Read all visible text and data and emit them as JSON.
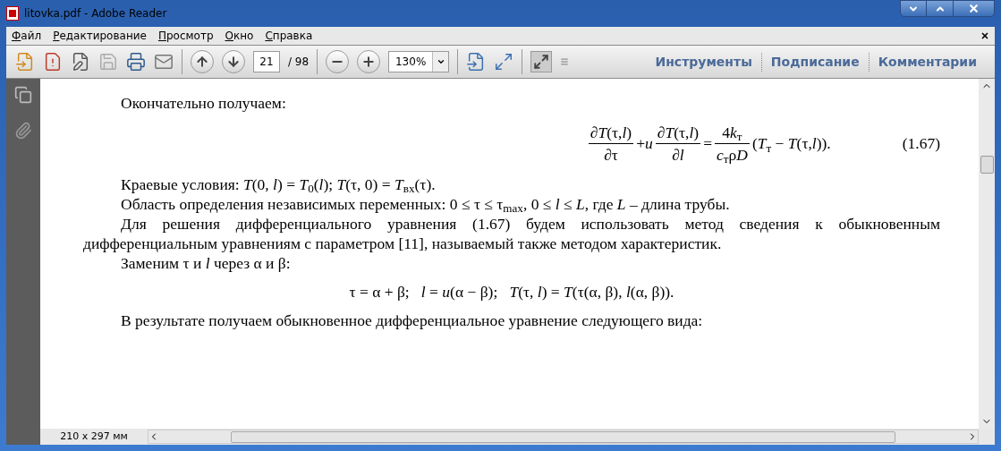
{
  "window": {
    "title": "litovka.pdf - Adobe Reader"
  },
  "menu": [
    "Файл",
    "Редактирование",
    "Просмотр",
    "Окно",
    "Справка"
  ],
  "toolbar": {
    "page_number": "21",
    "page_total": "/ 98",
    "zoom": "130%",
    "panels": [
      "Инструменты",
      "Подписание",
      "Комментарии"
    ]
  },
  "document": {
    "blocks": [
      {
        "kind": "paragraph",
        "text": "Окончательно получаем:"
      },
      {
        "kind": "equation",
        "number": "(1.67)",
        "terms": [
          {
            "kind": "fraction",
            "numerator": [
              "∂*T*(τ,*l*)"
            ],
            "denominator": [
              "∂τ"
            ]
          },
          {
            "kind": "text",
            "text": "+*u*"
          },
          {
            "kind": "fraction",
            "numerator": [
              "∂*T*(τ,*l*)"
            ],
            "denominator": [
              "∂*l*"
            ]
          },
          {
            "kind": "text",
            "text": "="
          },
          {
            "kind": "fraction",
            "numerator": [
              "4",
              "*k*$_{т}$"
            ],
            "denominator": [
              "*c*$_{т}$ρ",
              "*D*"
            ]
          },
          {
            "kind": "text",
            "text": "(*T*$_{т}$ − *T*(τ,*l*))."
          }
        ]
      },
      {
        "kind": "paragraph",
        "text": "Краевые условия: *T*(0,  *l*) = *T*$_{0}$(*l*); *T*(τ, 0) = *T*$_{вх}$(τ)."
      },
      {
        "kind": "paragraph",
        "text": "Область определения независимых переменных: 0 ≤ τ ≤ τ$_{max}$, 0 ≤ *l* ≤ *L*, где *L* – длина трубы."
      },
      {
        "kind": "paragraph",
        "text": "Для решения дифференциального уравнения (1.67) будем использовать метод сведения к обыкновенным дифференциальным уравнениям с параметром [11], называемый также методом характеристик."
      },
      {
        "kind": "paragraph",
        "text": "Заменим τ и *l* через α и β:"
      },
      {
        "kind": "formula",
        "text": "τ = α + β;   *l* = *u*(α − β);   *T*(τ, *l*) = *T*(τ(α, β), *l*(α, β))."
      },
      {
        "kind": "paragraph",
        "text": "В результате получаем обыкновенное дифференциальное уравнение следующего вида:"
      }
    ]
  },
  "status_bar": {
    "page_size": "210 x 297 мм"
  }
}
